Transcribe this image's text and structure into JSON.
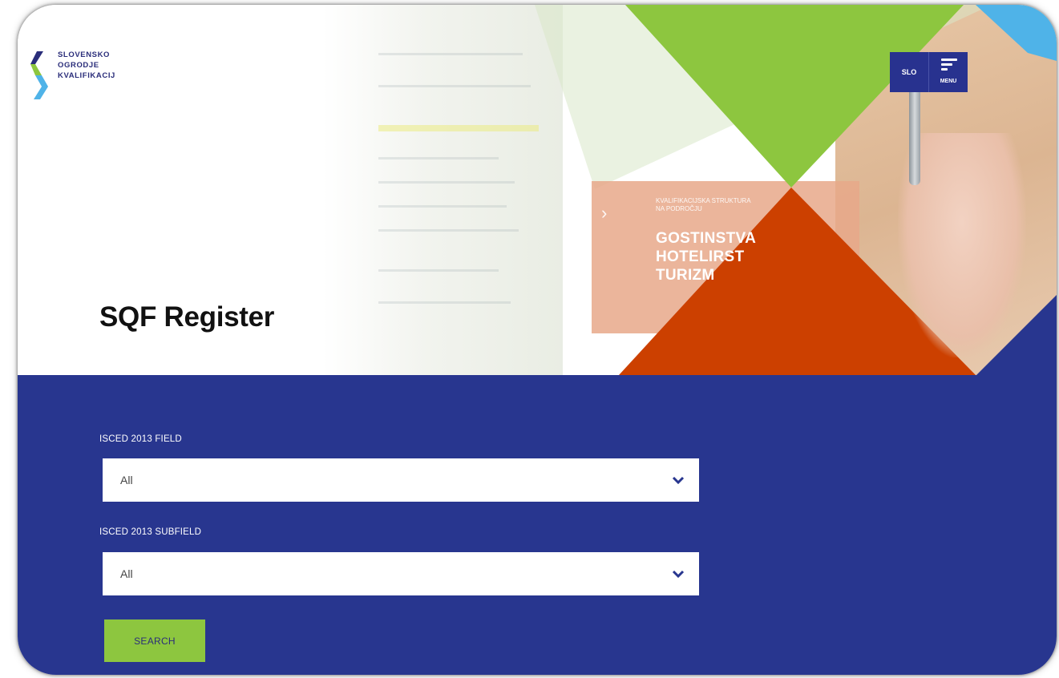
{
  "brand": {
    "logo_lines": [
      "SLOVENSKO",
      "OGRODJE",
      "KVALIFIKACIJ"
    ]
  },
  "header": {
    "language_label": "SLO",
    "menu_label": "MENU"
  },
  "hero": {
    "title": "SQF Register",
    "book_subtitle_lines": [
      "KVALIFIKACIJSKA STRUKTURA",
      "NA PODROČJU"
    ],
    "book_title_lines": [
      "GOSTINSTVA",
      "HOTELIRST",
      "TURIZM"
    ]
  },
  "search": {
    "field": {
      "label": "ISCED 2013 FIELD",
      "value": "All"
    },
    "subfield": {
      "label": "ISCED 2013 SUBFIELD",
      "value": "All"
    },
    "button_label": "SEARCH"
  },
  "colors": {
    "navy": "#28368f",
    "green": "#8dc63f",
    "orange": "#cc4000",
    "light_blue": "#4fb3e8"
  },
  "icons": [
    "logo-chevron-icon",
    "hamburger-icon",
    "chevron-down-icon"
  ]
}
